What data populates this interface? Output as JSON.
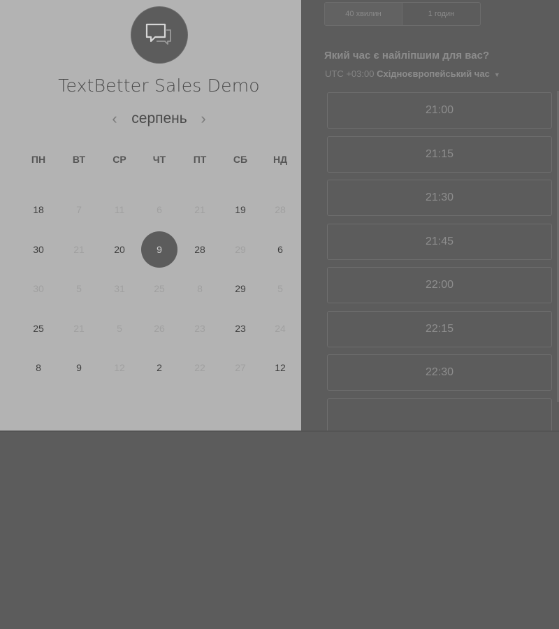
{
  "header": {
    "title": "TextBetter Sales Demo",
    "logo_icon": "chat-bubble-icon"
  },
  "calendar": {
    "month": "серпень",
    "prev_icon": "chevron-left-icon",
    "next_icon": "chevron-right-icon",
    "weekdays": [
      "ПН",
      "ВТ",
      "СР",
      "ЧТ",
      "ПТ",
      "СБ",
      "НД"
    ],
    "weeks": [
      [
        {
          "d": "18",
          "s": "on"
        },
        {
          "d": "7",
          "s": "off"
        },
        {
          "d": "11",
          "s": "off"
        },
        {
          "d": "6",
          "s": "off"
        },
        {
          "d": "21",
          "s": "off"
        },
        {
          "d": "19",
          "s": "on"
        },
        {
          "d": "28",
          "s": "off"
        }
      ],
      [
        {
          "d": "30",
          "s": "on"
        },
        {
          "d": "21",
          "s": "off"
        },
        {
          "d": "20",
          "s": "on"
        },
        {
          "d": "9",
          "s": "sel"
        },
        {
          "d": "28",
          "s": "on"
        },
        {
          "d": "29",
          "s": "off"
        },
        {
          "d": "6",
          "s": "on"
        }
      ],
      [
        {
          "d": "30",
          "s": "off"
        },
        {
          "d": "5",
          "s": "off"
        },
        {
          "d": "31",
          "s": "off"
        },
        {
          "d": "25",
          "s": "off"
        },
        {
          "d": "8",
          "s": "off"
        },
        {
          "d": "29",
          "s": "on"
        },
        {
          "d": "5",
          "s": "off"
        }
      ],
      [
        {
          "d": "25",
          "s": "on"
        },
        {
          "d": "21",
          "s": "off"
        },
        {
          "d": "5",
          "s": "off"
        },
        {
          "d": "26",
          "s": "off"
        },
        {
          "d": "23",
          "s": "off"
        },
        {
          "d": "23",
          "s": "on"
        },
        {
          "d": "24",
          "s": "off"
        }
      ],
      [
        {
          "d": "8",
          "s": "on"
        },
        {
          "d": "9",
          "s": "on"
        },
        {
          "d": "12",
          "s": "off"
        },
        {
          "d": "2",
          "s": "on"
        },
        {
          "d": "22",
          "s": "off"
        },
        {
          "d": "27",
          "s": "off"
        },
        {
          "d": "12",
          "s": "on"
        }
      ]
    ]
  },
  "duration": {
    "options": [
      "40 хвилин",
      "1 годин"
    ],
    "selected_index": 0
  },
  "booking": {
    "question": "Який час є найліпшим для вас?",
    "timezone_offset": "UTC +03:00",
    "timezone_name": "Східноєвропейський час",
    "dropdown_icon": "caret-down-icon",
    "slots": [
      "21:00",
      "21:15",
      "21:30",
      "21:45",
      "22:00",
      "22:15",
      "22:30"
    ]
  },
  "colors": {
    "left_panel": "#b3b3b3",
    "right_panel": "#5c5c5c",
    "selected_day": "#5c5c5c"
  }
}
